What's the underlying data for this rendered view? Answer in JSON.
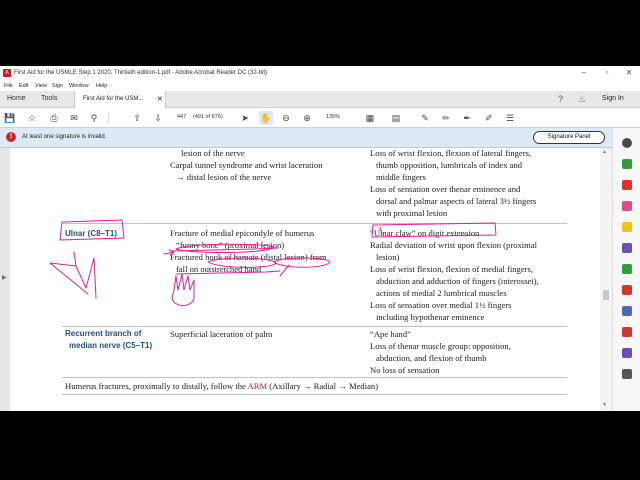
{
  "window": {
    "title": "First Aid for the USMLE Step 1 2020, Thirtieth edition-1.pdf - Adobe Acrobat Reader DC (32-bit)",
    "controls": [
      "–",
      "▫",
      "✕"
    ]
  },
  "menu": [
    "File",
    "Edit",
    "View",
    "Sign",
    "Window",
    "Help"
  ],
  "tabs": {
    "home": "Home",
    "tools": "Tools",
    "document": "First Aid for the USM...",
    "close": "✕",
    "sign_in": "Sign In"
  },
  "toolbar": {
    "page_current": "447",
    "page_info": "(491 of 876)",
    "zoom": "135%"
  },
  "signature": {
    "message": "At least one signature is invalid.",
    "button": "Signature Panel"
  },
  "document": {
    "rows": [
      {
        "id": "median",
        "heading": [],
        "cause": [
          "lesion of the nerve",
          "Carpal tunnel syndrome and wrist laceration",
          "→ distal lesion of the nerve"
        ],
        "findings": [
          "Loss of wrist flexion, flexion of lateral fingers,",
          "thumb opposition, lumbricals of index and",
          "middle fingers",
          "Loss of sensation over thenar eminence and",
          "dorsal and palmar aspects of lateral 3½ fingers",
          "with proximal lesion"
        ]
      },
      {
        "id": "ulnar",
        "heading": [
          "Ulnar (C8–T1)"
        ],
        "cause": [
          "Fracture of medial epicondyle of humerus",
          "“funny bone” (proximal lesion)",
          "Fractured hook of hamate (distal lesion) from",
          "fall on outstretched hand"
        ],
        "findings": [
          "“Ulnar claw” on digit extension",
          "Radial deviation of wrist upon flexion (proximal",
          "lesion)",
          "Loss of wrist flexion, flexion of medial fingers,",
          "abduction and adduction of fingers (interossei),",
          "actions of medial 2 lumbrical muscles",
          "Loss of sensation over medial 1½ fingers",
          "including hypothenar eminence"
        ]
      },
      {
        "id": "recurrent",
        "heading": [
          "Recurrent branch of",
          "median nerve (C5–T1)"
        ],
        "cause": [
          "Superficial laceration of palm"
        ],
        "findings": [
          "“Ape hand”",
          "Loss of thenar muscle group: opposition,",
          "abduction, and flexion of thumb",
          "No loss of sensation"
        ]
      }
    ],
    "footnote": {
      "lead": "Humerus fractures, proximally to distally, follow the ",
      "arm": "ARM",
      "rest": " (Axillary → Radial → Median)"
    }
  },
  "colors": {
    "heading_blue": "#1f4e85",
    "annotation_pink": "#e0208f",
    "sig_banner": "#dde9f5",
    "acrobat_red": "#c3211a"
  },
  "icons": {
    "toolbar": [
      "save-icon",
      "bookmark-star-icon",
      "print-icon",
      "email-icon",
      "search-icon",
      "page-up-icon",
      "page-down-icon",
      "select-arrow-icon",
      "hand-icon",
      "zoom-out-icon",
      "zoom-in-icon",
      "fit-page-icon",
      "scroll-mode-icon",
      "comment-icon",
      "highlight-icon",
      "draw-icon",
      "fill-sign-icon",
      "more-tools-icon"
    ],
    "right_panel": [
      "zoom-icon",
      "export-pdf-icon",
      "create-pdf-icon",
      "edit-pdf-icon",
      "comment-icon",
      "combine-icon",
      "organize-icon",
      "redact-icon",
      "protect-icon",
      "compress-icon",
      "fill-sign-icon",
      "more-tools-icon"
    ]
  }
}
